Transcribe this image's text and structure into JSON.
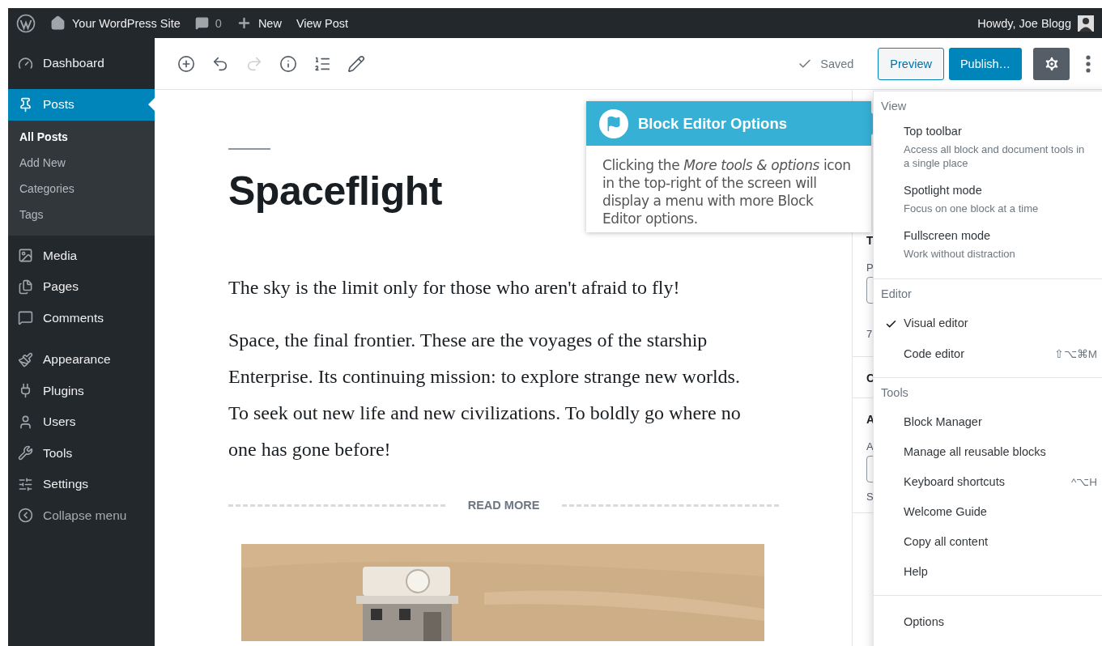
{
  "admin_bar": {
    "site": "Your WordPress Site",
    "comments": "0",
    "new": "New",
    "view_post": "View Post",
    "greeting": "Howdy, Joe Blogg"
  },
  "sidebar": {
    "items": [
      {
        "label": "Dashboard",
        "selected": false
      },
      {
        "label": "Posts",
        "selected": true,
        "children": [
          {
            "label": "All Posts",
            "selected": true
          },
          {
            "label": "Add New",
            "selected": false
          },
          {
            "label": "Categories",
            "selected": false
          },
          {
            "label": "Tags",
            "selected": false
          }
        ]
      },
      {
        "label": "Media",
        "selected": false
      },
      {
        "label": "Pages",
        "selected": false
      },
      {
        "label": "Comments",
        "selected": false
      },
      {
        "label": "Appearance",
        "selected": false
      },
      {
        "label": "Plugins",
        "selected": false
      },
      {
        "label": "Users",
        "selected": false
      },
      {
        "label": "Tools",
        "selected": false
      },
      {
        "label": "Settings",
        "selected": false
      },
      {
        "label": "Collapse menu",
        "selected": false
      }
    ]
  },
  "toolbar": {
    "tools": [
      {
        "disabled": false
      },
      {
        "disabled": false
      },
      {
        "disabled": true
      },
      {
        "disabled": false
      },
      {
        "disabled": false
      },
      {
        "disabled": false
      }
    ],
    "status": "Saved",
    "preview": "Preview",
    "publish": "Publish…",
    "settings_pressed": true
  },
  "post": {
    "title": "Spaceflight",
    "paragraphs": [
      "The sky is the limit only for those who aren't afraid to fly!",
      "Space, the final frontier. These are the voyages of the starship Enterprise. Its continuing mission: to explore strange new worlds. To seek out new life and new civilizations. To boldly go where no one has gone before!"
    ],
    "read_more": "READ MORE",
    "image": {
      "kind": "picture"
    }
  },
  "settings_panel": [
    {
      "kind": "heading",
      "text": "T"
    },
    {
      "kind": "label",
      "text": "P"
    },
    {
      "kind": "field"
    },
    {
      "kind": "radio",
      "text": "7"
    },
    {
      "kind": "divider"
    },
    {
      "kind": "heading",
      "text": "C"
    },
    {
      "kind": "divider"
    },
    {
      "kind": "heading",
      "text": "A"
    },
    {
      "kind": "label",
      "text": "A"
    },
    {
      "kind": "field"
    },
    {
      "kind": "label",
      "text": "S"
    },
    {
      "kind": "divider"
    }
  ],
  "tooltip": {
    "title": "Block Editor Options",
    "body": "Clicking the *More tools & options* icon in the top-right of the screen will display a menu with more Block Editor options."
  },
  "menu": {
    "sections": [
      {
        "title": "View",
        "items": [
          {
            "kind": "option",
            "label": "Top toolbar",
            "description": "Access all block and document tools in a single place"
          },
          {
            "kind": "option",
            "label": "Spotlight mode",
            "description": "Focus on one block at a time"
          },
          {
            "kind": "option",
            "label": "Fullscreen mode",
            "description": "Work without distraction"
          }
        ]
      },
      {
        "title": "Editor",
        "items": [
          {
            "kind": "check",
            "label": "Visual editor",
            "checked": true
          },
          {
            "kind": "check",
            "label": "Code editor",
            "checked": false,
            "shortcut": "⇧⌥⌘M"
          }
        ]
      },
      {
        "title": "Tools",
        "items": [
          {
            "kind": "plain",
            "label": "Block Manager"
          },
          {
            "kind": "plain",
            "label": "Manage all reusable blocks"
          },
          {
            "kind": "plain",
            "label": "Keyboard shortcuts",
            "shortcut": "^⌥H"
          },
          {
            "kind": "plain",
            "label": "Welcome Guide"
          },
          {
            "kind": "plain",
            "label": "Copy all content"
          },
          {
            "kind": "plain",
            "label": "Help"
          }
        ]
      },
      {
        "items": [
          {
            "kind": "plain",
            "label": "Options"
          }
        ]
      }
    ]
  }
}
